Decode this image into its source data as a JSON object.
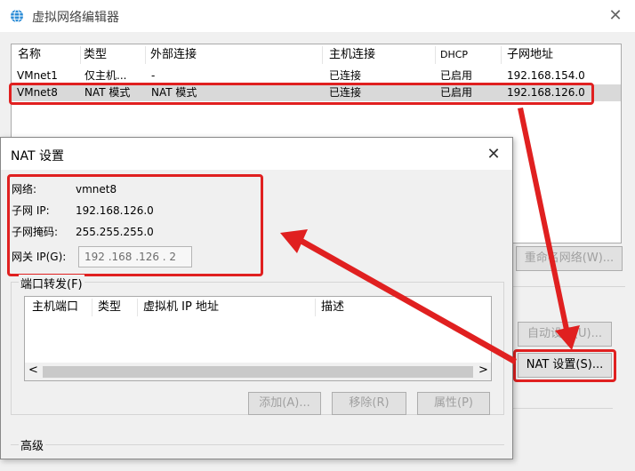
{
  "main": {
    "title": "虚拟网络编辑器",
    "close_glyph": "✕",
    "table": {
      "headers": [
        "名称",
        "类型",
        "外部连接",
        "主机连接",
        "DHCP",
        "子网地址"
      ],
      "rows": [
        [
          "VMnet1",
          "仅主机...",
          "-",
          "已连接",
          "已启用",
          "192.168.154.0"
        ],
        [
          "VMnet8",
          "NAT 模式",
          "NAT 模式",
          "已连接",
          "已启用",
          "192.168.126.0"
        ]
      ]
    },
    "rename_button": "重命名网络(W)...",
    "auto_settings_button": "自动设置(U)...",
    "nat_settings_button": "NAT 设置(S)..."
  },
  "nat": {
    "title": "NAT 设置",
    "close_glyph": "✕",
    "network_label": "网络:",
    "network_value": "vmnet8",
    "subnet_ip_label": "子网 IP:",
    "subnet_ip_value": "192.168.126.0",
    "subnet_mask_label": "子网掩码:",
    "subnet_mask_value": "255.255.255.0",
    "gateway_label": "网关 IP(G):",
    "gateway_value": "192 .168 .126 . 2",
    "port_forwarding": {
      "legend": "端口转发(F)",
      "headers": [
        "主机端口",
        "类型",
        "虚拟机 IP 地址",
        "描述"
      ],
      "scroll_left": "<",
      "scroll_right": ">"
    },
    "add_button": "添加(A)...",
    "remove_button": "移除(R)",
    "properties_button": "属性(P)",
    "advanced_legend": "高级"
  },
  "colors": {
    "highlight": "#e02020",
    "selected_row": "#d9d9d9",
    "app_icon": "#2a8bd6"
  },
  "icons": {
    "app": "globe-network-icon",
    "close": "close-icon"
  }
}
